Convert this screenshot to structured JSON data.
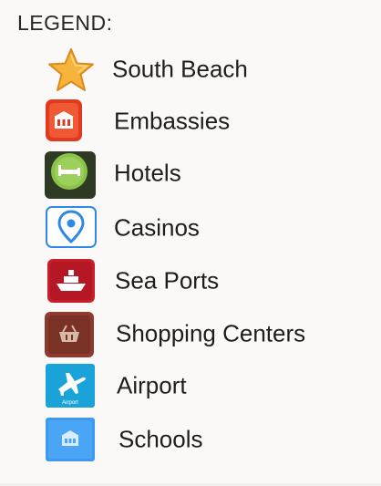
{
  "legend": {
    "title": "LEGEND:",
    "items": [
      {
        "label": "South Beach",
        "icon": "star-icon"
      },
      {
        "label": "Embassies",
        "icon": "embassy-icon"
      },
      {
        "label": "Hotels",
        "icon": "hotel-bed-icon"
      },
      {
        "label": "Casinos",
        "icon": "map-pin-icon"
      },
      {
        "label": "Sea Ports",
        "icon": "ship-icon"
      },
      {
        "label": "Shopping Centers",
        "icon": "shopping-basket-icon"
      },
      {
        "label": "Airport",
        "icon": "airplane-icon",
        "icon_text": "Airport"
      },
      {
        "label": "Schools",
        "icon": "school-icon"
      }
    ]
  },
  "colors": {
    "star": "#f6b53a",
    "embassy": "#e23a1f",
    "hotel": "#8bc34a",
    "casino": "#2f88e6",
    "sea_port": "#c81e2b",
    "shopping": "#8e3b2d",
    "airport": "#1aa3d8",
    "school": "#3d9af0"
  }
}
